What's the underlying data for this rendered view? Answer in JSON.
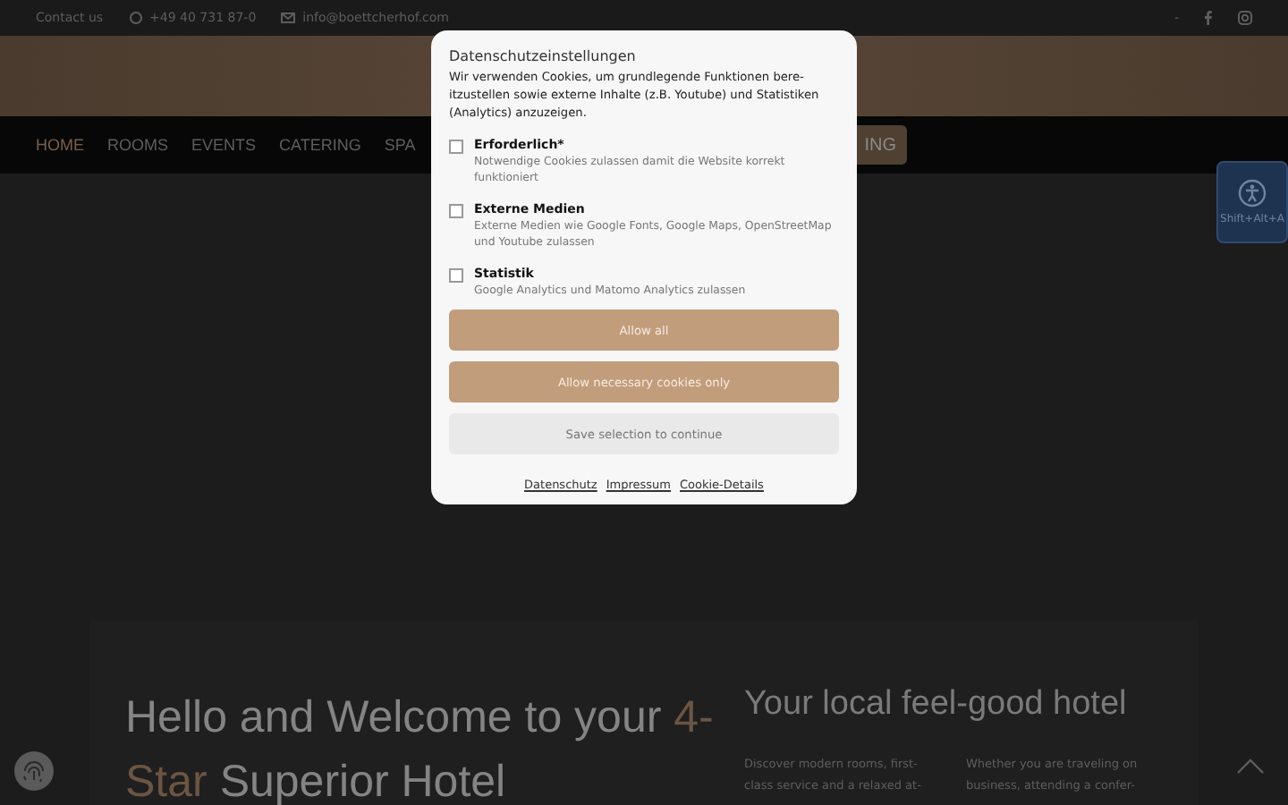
{
  "top_bar": {
    "contact_label": "Contact us",
    "phone": "+49 40 731 87-0",
    "email": "info@boettcherhof.com",
    "social_separator": "-"
  },
  "nav": {
    "items": [
      {
        "label": "HOME",
        "selected": true
      },
      {
        "label": "ROOMS",
        "selected": false
      },
      {
        "label": "EVENTS",
        "selected": false
      },
      {
        "label": "CATERING",
        "selected": false
      },
      {
        "label": "SPA",
        "selected": false
      }
    ],
    "booking_button": "ING"
  },
  "accessibility_widget": {
    "shortcut": "Shift+Alt+A"
  },
  "welcome": {
    "heading_before": "Hello and Welcome to your",
    "heading_highlight": "4-Star",
    "heading_after": "Superior Hotel",
    "subheading": "Your local feel-good hotel",
    "paragraphs": [
      [
        "Discover modern rooms, first-",
        "class service and a relaxed at-"
      ],
      [
        "Whether you are traveling on",
        "business, attending a confer-"
      ]
    ]
  },
  "cookie_dialog": {
    "title": "Datenschutzeinstellungen",
    "intro": "Wir verwenden Cookies, um grundlegende Funktionen bere-itzustellen sowie externe Inhalte (z.B. Youtube) und Statistiken (Analytics) anzuzeigen.",
    "options": [
      {
        "label": "Erforderlich*",
        "description": "Notwendige Cookies zulassen damit die Website korrekt funktioniert",
        "checked": false
      },
      {
        "label": "Externe Medien",
        "description": "Externe Medien wie Google Fonts, Google Maps, OpenStreetMap und Youtube zulassen",
        "checked": false
      },
      {
        "label": "Statistik",
        "description": "Google Analytics und Matomo Analytics zulassen",
        "checked": false
      }
    ],
    "buttons": [
      {
        "label": "Allow all",
        "kind": "primary"
      },
      {
        "label": "Allow necessary cookies only",
        "kind": "primary"
      },
      {
        "label": "Save selection to continue",
        "kind": "secondary"
      }
    ],
    "links": [
      "Datenschutz",
      "Impressum",
      "Cookie-Details"
    ]
  }
}
